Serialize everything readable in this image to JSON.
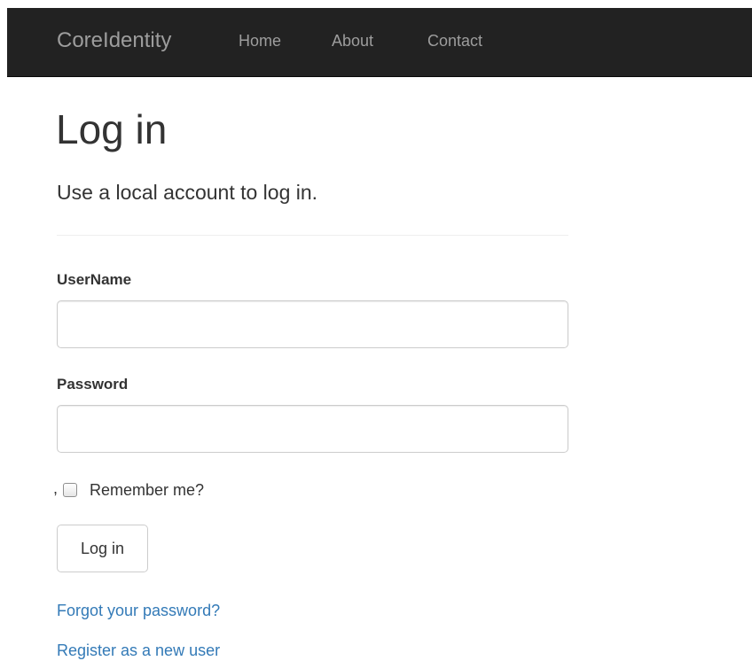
{
  "navbar": {
    "brand": "CoreIdentity",
    "links": [
      "Home",
      "About",
      "Contact"
    ]
  },
  "page": {
    "title": "Log in",
    "subtitle": "Use a local account to log in."
  },
  "form": {
    "username_label": "UserName",
    "username_value": "",
    "password_label": "Password",
    "password_value": "",
    "remember_prefix": ",",
    "remember_label": "Remember me?",
    "remember_checked": false,
    "submit_label": "Log in"
  },
  "links": {
    "forgot_password": "Forgot your password?",
    "register": "Register as a new user"
  },
  "colors": {
    "navbar_bg": "#222222",
    "navbar_text": "#9d9d9d",
    "link": "#337ab7",
    "text": "#333333"
  }
}
